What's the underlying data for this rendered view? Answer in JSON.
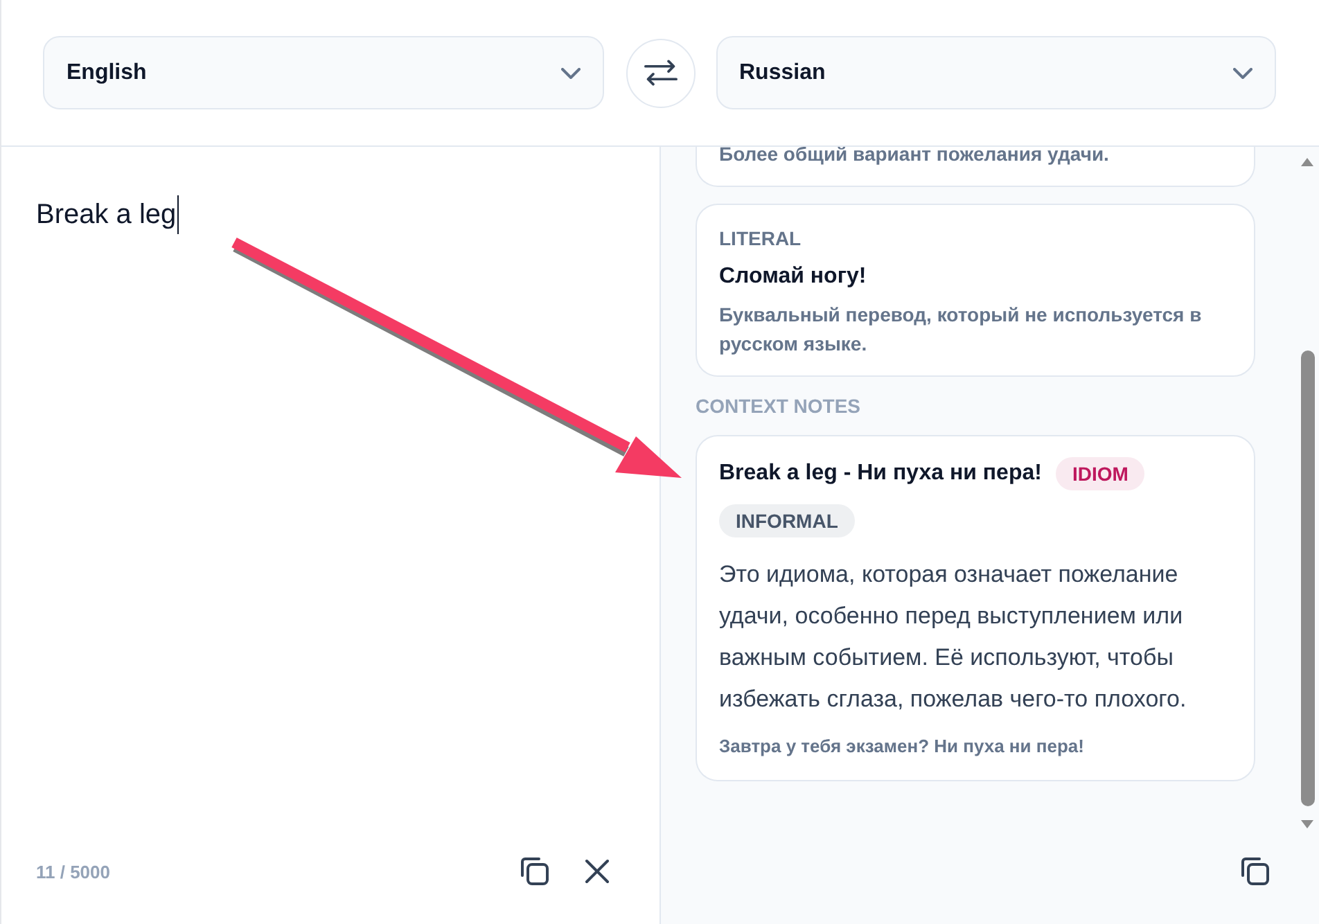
{
  "language_bar": {
    "source": {
      "value": "English"
    },
    "swap": {
      "kind": "swap"
    },
    "target": {
      "value": "Russian"
    }
  },
  "source_panel": {
    "text": {
      "value": "Break a leg",
      "focused": true
    },
    "char_count": "11 / 5000",
    "actions": [
      {
        "kind": "copy"
      },
      {
        "kind": "clear"
      }
    ]
  },
  "result_panel": {
    "translations": [
      {
        "description": "Более общий вариант пожелания удачи."
      },
      {
        "label": "LITERAL",
        "translation": "Сломай ногу!",
        "description": "Буквальный перевод, который не используется в русском языке."
      }
    ],
    "context_notes": {
      "heading": "CONTEXT NOTES",
      "notes": [
        {
          "title": "Break a leg - Ни пуха ни пера!",
          "tags": [
            {
              "label": "IDIOM",
              "color": "#be185d"
            },
            {
              "label": "INFORMAL",
              "color": "#475569"
            }
          ],
          "body": "Это идиома, которая означает пожелание удачи, особенно перед выступлением или важным событием. Её используют, чтобы избежать сглаза, пожелав чего-то плохого.",
          "example": "Завтра у тебя экзамен? Ни пуха ни пера!"
        }
      ]
    },
    "actions": [
      {
        "kind": "copy"
      }
    ]
  },
  "annotations": [
    {
      "kind": "arrow"
    }
  ]
}
